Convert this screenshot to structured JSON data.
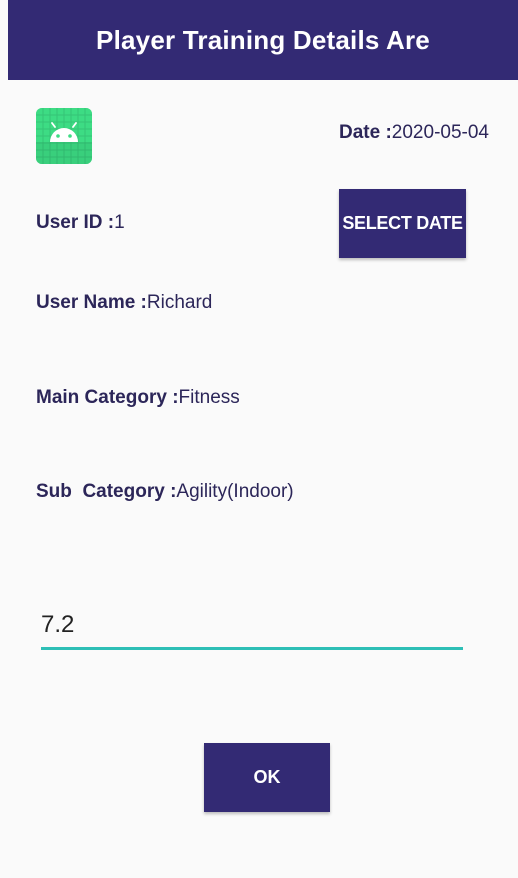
{
  "app_bar": {
    "title": "Player Training Details Are"
  },
  "icons": {
    "app_icon": "android-robot-icon"
  },
  "details": {
    "date_label": "Date :",
    "date_value": "2020-05-04",
    "user_id_label": "User ID :",
    "user_id_value": "1",
    "user_name_label": "User Name :",
    "user_name_value": "Richard",
    "main_category_label": "Main Category :",
    "main_category_value": "Fitness",
    "sub_category_label": "Sub  Category :",
    "sub_category_value": "Agility(Indoor)"
  },
  "buttons": {
    "select_date_label": "SELECT DATE",
    "ok_label": "OK"
  },
  "input": {
    "value": "7.2"
  },
  "colors": {
    "primary": "#332a74",
    "text": "#2c2659",
    "accent_underline": "#2ebfb6",
    "background": "#fafafa",
    "icon_green": "#3ddc84"
  }
}
